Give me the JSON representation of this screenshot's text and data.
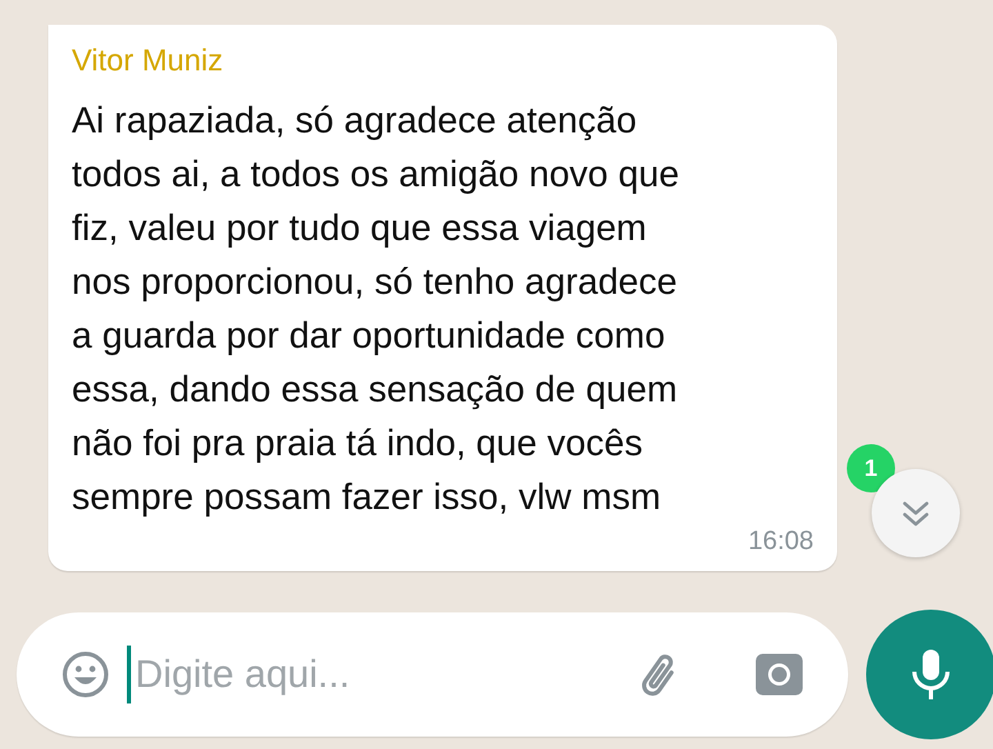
{
  "message": {
    "sender": "Vitor Muniz",
    "text": "Ai rapaziada, só agradece atenção\ntodos ai, a todos os amigão novo que\nfiz, valeu por tudo que essa viagem\nnos proporcionou, só tenho agradece\na guarda por dar oportunidade como\nessa, dando essa sensação de quem\nnão foi pra praia tá indo, que vocês\nsempre possam fazer isso, vlw msm",
    "time": "16:08"
  },
  "unread_badge": "1",
  "composer": {
    "placeholder": "Digite aqui..."
  }
}
